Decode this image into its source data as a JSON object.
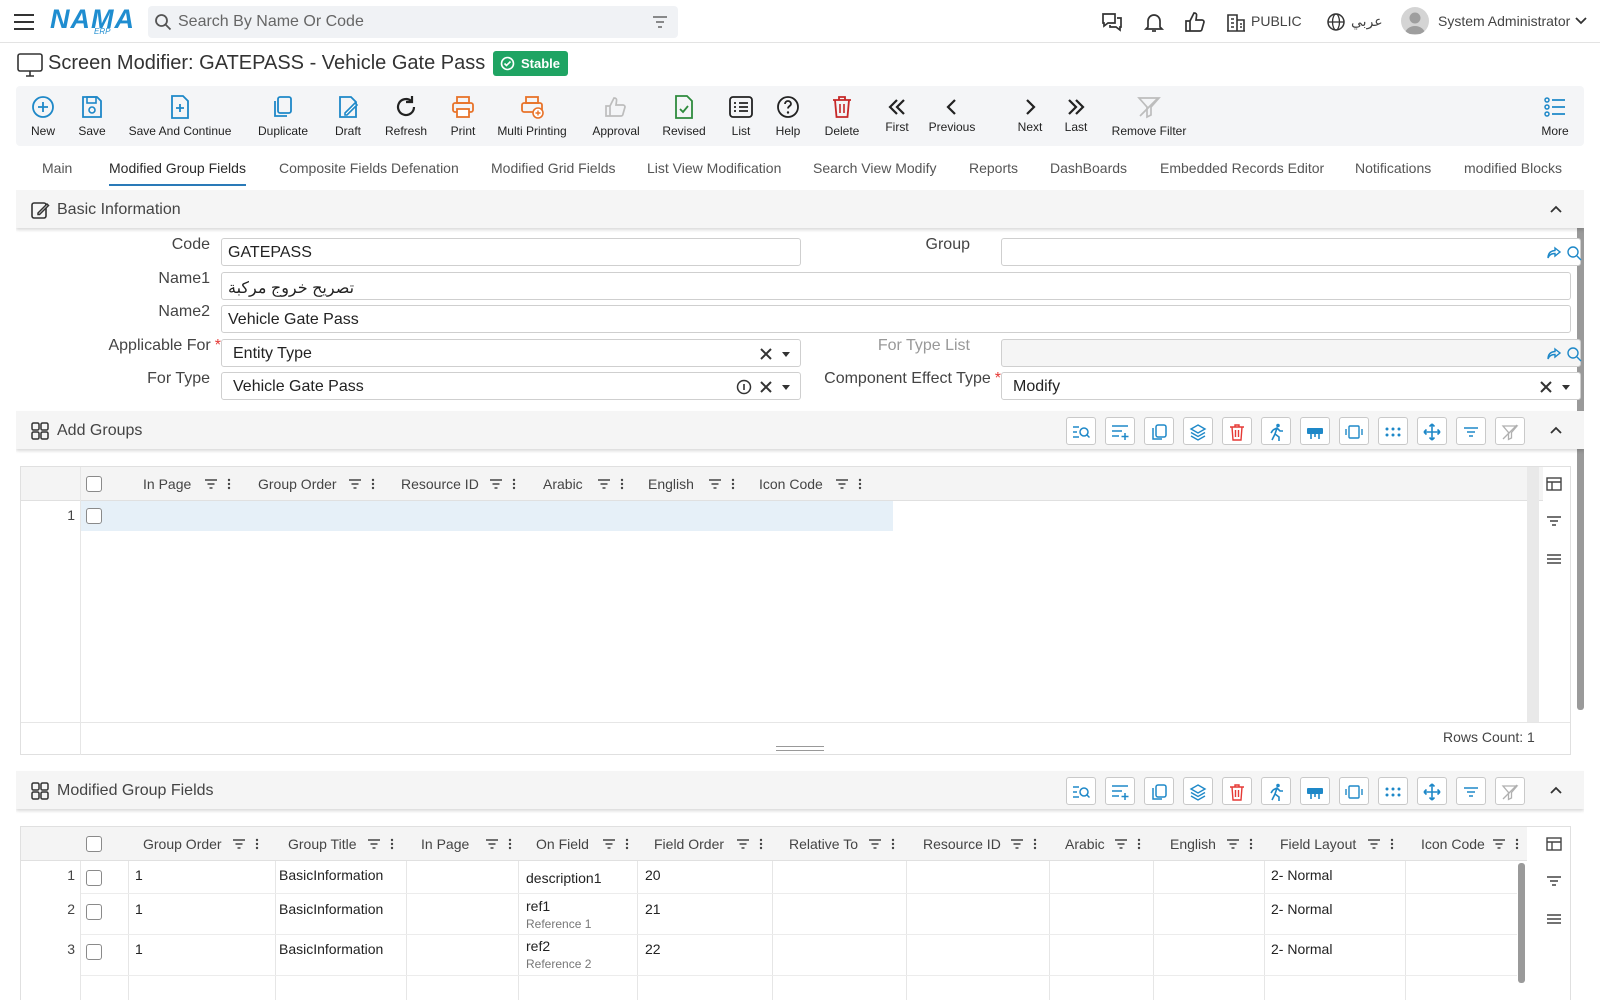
{
  "header": {
    "logo_main": "NAMA",
    "logo_sub": "ERP",
    "search_placeholder": "Search By Name Or Code",
    "company": "PUBLIC",
    "language": "عربي",
    "user": "System Administrator"
  },
  "page": {
    "title": "Screen Modifier: GATEPASS - Vehicle Gate Pass",
    "status": "Stable"
  },
  "toolbar": [
    {
      "label": "New",
      "icon": "plus-circle-icon",
      "color": "#1e88c8"
    },
    {
      "label": "Save",
      "icon": "save-icon",
      "color": "#1e88c8"
    },
    {
      "label": "Save And Continue",
      "icon": "save-continue-icon",
      "color": "#1e88c8"
    },
    {
      "label": "Duplicate",
      "icon": "duplicate-icon",
      "color": "#1e88c8"
    },
    {
      "label": "Draft",
      "icon": "draft-icon",
      "color": "#1e88c8"
    },
    {
      "label": "Refresh",
      "icon": "refresh-icon",
      "color": "#222222"
    },
    {
      "label": "Print",
      "icon": "print-icon",
      "color": "#e8732a"
    },
    {
      "label": "Multi Printing",
      "icon": "multi-print-icon",
      "color": "#e8732a"
    },
    {
      "label": "Approval",
      "icon": "thumbs-up-icon",
      "color": "#bdbdbd"
    },
    {
      "label": "Revised",
      "icon": "revised-icon",
      "color": "#2e8b3d"
    },
    {
      "label": "List",
      "icon": "list-icon",
      "color": "#222222"
    },
    {
      "label": "Help",
      "icon": "help-icon",
      "color": "#222222"
    },
    {
      "label": "Delete",
      "icon": "trash-icon",
      "color": "#c62828"
    },
    {
      "label": "First",
      "icon": "first-icon",
      "color": "#222222"
    },
    {
      "label": "Previous",
      "icon": "previous-icon",
      "color": "#222222"
    },
    {
      "label": "Next",
      "icon": "next-icon",
      "color": "#222222"
    },
    {
      "label": "Last",
      "icon": "last-icon",
      "color": "#222222"
    },
    {
      "label": "Remove Filter",
      "icon": "remove-filter-icon",
      "color": "#bdbdbd"
    },
    {
      "label": "More",
      "icon": "more-icon",
      "color": "#1e88c8"
    }
  ],
  "tabs": [
    {
      "label": "Main"
    },
    {
      "label": "Modified Group Fields",
      "active": true
    },
    {
      "label": "Composite Fields Defenation"
    },
    {
      "label": "Modified Grid Fields"
    },
    {
      "label": "List View Modification"
    },
    {
      "label": "Search View Modify"
    },
    {
      "label": "Reports"
    },
    {
      "label": "DashBoards"
    },
    {
      "label": "Embedded Records Editor"
    },
    {
      "label": "Notifications"
    },
    {
      "label": "modified Blocks"
    }
  ],
  "basic_info": {
    "title": "Basic Information",
    "code_label": "Code",
    "code_value": "GATEPASS",
    "group_label": "Group",
    "group_value": "",
    "name1_label": "Name1",
    "name1_value": "تصريح خروج مركبة",
    "name2_label": "Name2",
    "name2_value": "Vehicle Gate Pass",
    "applicable_label": "Applicable For",
    "applicable_value": "Entity Type",
    "for_type_list_label": "For Type List",
    "for_type_label": "For Type",
    "for_type_value": "Vehicle Gate Pass",
    "effect_label": "Component Effect Type",
    "effect_value": "Modify"
  },
  "add_groups": {
    "title": "Add Groups",
    "columns": [
      "In Page",
      "Group Order",
      "Resource ID",
      "Arabic",
      "English",
      "Icon Code"
    ],
    "rows": [
      {
        "num": "1"
      }
    ],
    "rows_count": "Rows Count: 1"
  },
  "modified_fields": {
    "title": "Modified Group Fields",
    "columns": [
      "Group Order",
      "Group Title",
      "In Page",
      "On Field",
      "Field Order",
      "Relative To",
      "Resource ID",
      "Arabic",
      "English",
      "Field Layout",
      "Icon Code"
    ],
    "rows": [
      {
        "num": "1",
        "group_order": "1",
        "group_title": "BasicInformation",
        "on_field": "description1",
        "on_field_sub": "",
        "field_order": "20",
        "field_layout": "2- Normal"
      },
      {
        "num": "2",
        "group_order": "1",
        "group_title": "BasicInformation",
        "on_field": "ref1",
        "on_field_sub": "Reference 1",
        "field_order": "21",
        "field_layout": "2- Normal"
      },
      {
        "num": "3",
        "group_order": "1",
        "group_title": "BasicInformation",
        "on_field": "ref2",
        "on_field_sub": "Reference 2",
        "field_order": "22",
        "field_layout": "2- Normal"
      }
    ]
  },
  "colors": {
    "brand": "#1f8dd0",
    "stable_badge": "#1fa463",
    "active_tab_underline": "#2a7ab8",
    "grid_tool_icon": "#1e88c8"
  }
}
